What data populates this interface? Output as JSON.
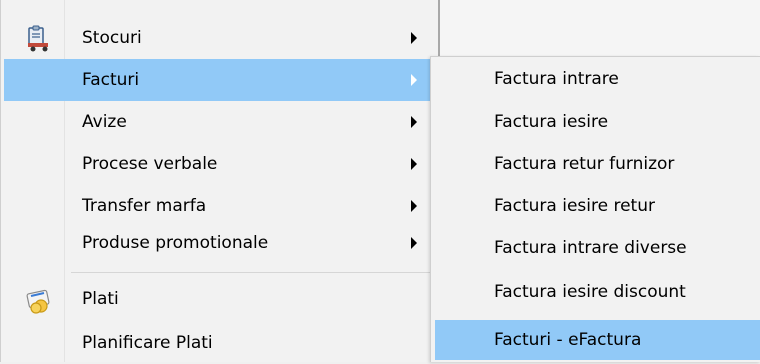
{
  "main_menu": {
    "items": [
      {
        "label": "Stocuri",
        "icon": "stock-icon",
        "submenu": true
      },
      {
        "label": "Facturi",
        "submenu": true,
        "highlighted": true
      },
      {
        "label": "Avize",
        "submenu": true
      },
      {
        "label": "Procese verbale",
        "submenu": true
      },
      {
        "label": "Transfer marfa",
        "submenu": true
      },
      {
        "label": "Produse promotionale",
        "submenu": true
      },
      {
        "label": "Plati",
        "icon": "payment-icon"
      },
      {
        "label": "Planificare Plati"
      }
    ]
  },
  "sub_menu": {
    "items": [
      {
        "label": "Factura intrare"
      },
      {
        "label": "Factura iesire"
      },
      {
        "label": "Factura retur furnizor"
      },
      {
        "label": "Factura iesire retur"
      },
      {
        "label": "Factura intrare diverse"
      },
      {
        "label": "Factura iesire discount"
      },
      {
        "label": "Facturi - eFactura",
        "highlighted": true
      }
    ]
  },
  "colors": {
    "menu_background": "#f2f2f2",
    "highlight": "#91c9f7"
  }
}
